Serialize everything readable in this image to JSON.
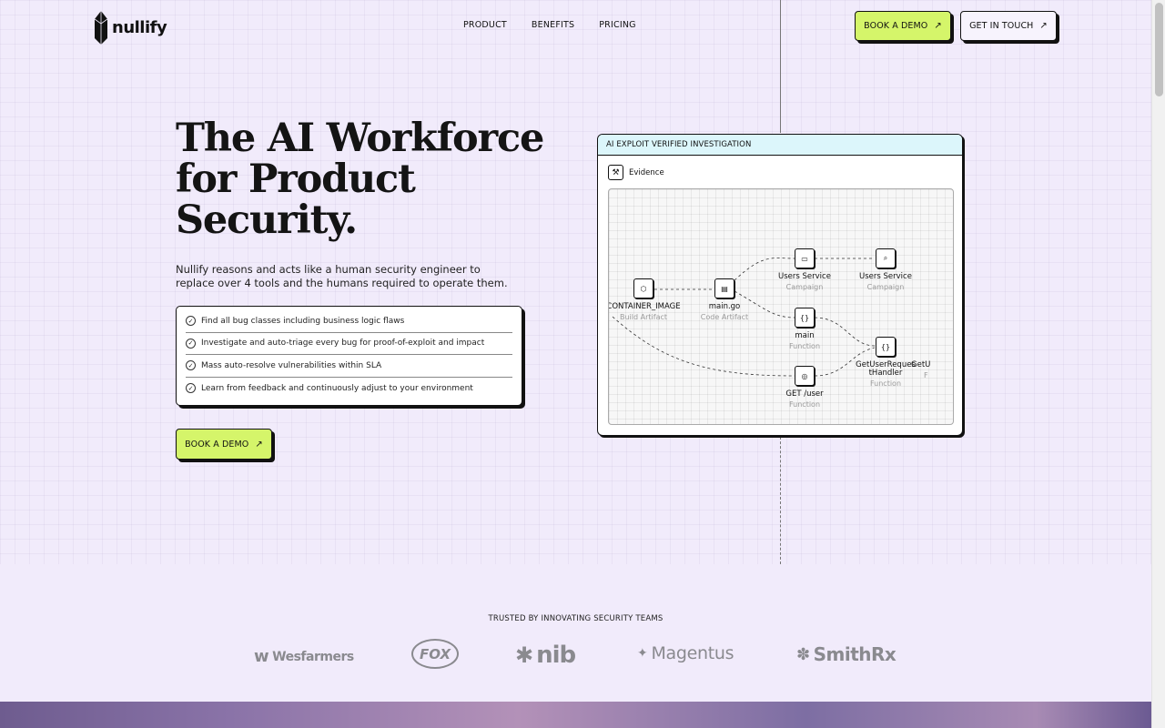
{
  "nav": {
    "brand": "nullify",
    "links": [
      "PRODUCT",
      "BENEFITS",
      "PRICING"
    ],
    "cta_demo": "BOOK A DEMO",
    "cta_touch": "GET IN TOUCH"
  },
  "hero": {
    "title": "The AI Workforce for Product Security.",
    "subtitle": "Nullify reasons and acts like a human security engineer to replace over 4 tools and the humans required to operate them.",
    "features": [
      "Find all bug classes including business logic flaws",
      "Investigate and auto-triage every bug for proof-of-exploit and impact",
      "Mass auto-resolve vulnerabilities within SLA",
      "Learn from feedback and continuously adjust to your environment"
    ],
    "cta": "BOOK A DEMO"
  },
  "panel": {
    "header": "AI EXPLOIT VERIFIED INVESTIGATION",
    "evidence_label": "Evidence",
    "nodes": [
      {
        "title": "CONTAINER_IMAGE",
        "type": "Build Artifact",
        "icon": "cube-icon"
      },
      {
        "title": "main.go",
        "type": "Code Artifact",
        "icon": "file-icon"
      },
      {
        "title": "Users Service",
        "type": "Campaign",
        "icon": "folder-icon"
      },
      {
        "title": "Users Service",
        "type": "Campaign",
        "icon": "folder-search-icon"
      },
      {
        "title": "main",
        "type": "Function",
        "icon": "braces-icon"
      },
      {
        "title": "GetUserRequestHandler",
        "type": "Function",
        "icon": "braces-icon"
      },
      {
        "title": "GET /user",
        "type": "Function",
        "icon": "globe-icon"
      },
      {
        "title": "GetU",
        "type": "F",
        "icon": "braces-icon"
      }
    ]
  },
  "trusted": {
    "label": "TRUSTED BY INNOVATING SECURITY TEAMS",
    "brands": [
      "Wesfarmers",
      "FOX",
      "nib",
      "Magentus",
      "SmithRx"
    ]
  },
  "colors": {
    "background": "#f1ebfb",
    "accent_lime": "#d5f56a",
    "panel_header": "#dcf6fb",
    "ink": "#111111"
  }
}
